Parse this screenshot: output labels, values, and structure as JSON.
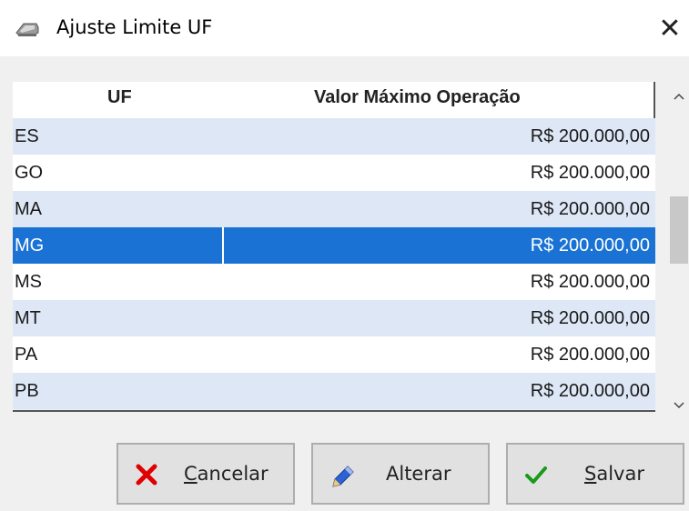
{
  "window": {
    "title": "Ajuste Limite UF",
    "close_glyph": "✕"
  },
  "grid": {
    "columns": [
      "UF",
      "Valor Máximo Operação"
    ],
    "rows": [
      {
        "uf": "ES",
        "valor": "R$ 200.000,00"
      },
      {
        "uf": "GO",
        "valor": "R$ 200.000,00"
      },
      {
        "uf": "MA",
        "valor": "R$ 200.000,00"
      },
      {
        "uf": "MG",
        "valor": "R$ 200.000,00",
        "selected": true
      },
      {
        "uf": "MS",
        "valor": "R$ 200.000,00"
      },
      {
        "uf": "MT",
        "valor": "R$ 200.000,00"
      },
      {
        "uf": "PA",
        "valor": "R$ 200.000,00"
      },
      {
        "uf": "PB",
        "valor": "R$ 200.000,00"
      }
    ],
    "alt_row_color": "#dde7f6",
    "selected_row_color": "#1a73d4"
  },
  "buttons": {
    "cancel": {
      "first": "C",
      "rest": "ancelar",
      "icon": "close-x-icon",
      "color": "#e00000"
    },
    "alter": {
      "label": "Alterar",
      "icon": "pencil-edit-icon"
    },
    "save": {
      "first": "S",
      "rest": "alvar",
      "icon": "checkmark-icon",
      "color": "#1a9a1a"
    }
  }
}
